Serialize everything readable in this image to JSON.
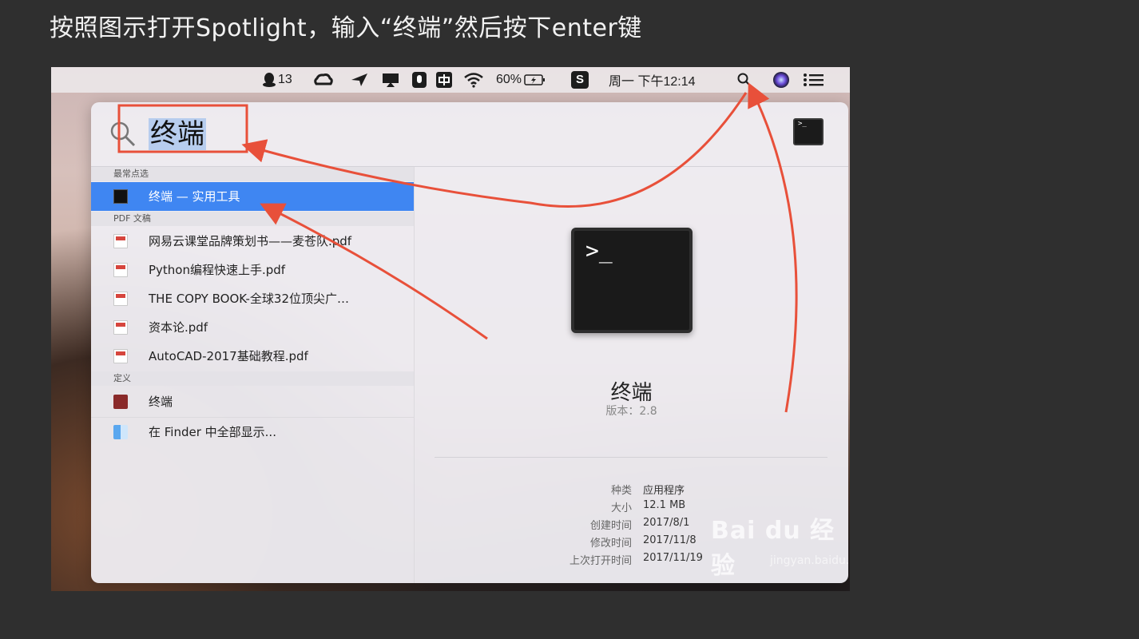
{
  "instruction": "按照图示打开Spotlight，输入“终端”然后按下enter键",
  "menubar": {
    "qq_count": "13",
    "battery": "60%",
    "input_method": "S",
    "clock": "周一 下午12:14"
  },
  "spotlight": {
    "query": "终端",
    "sections": [
      {
        "title": "最常点选",
        "items": [
          {
            "label": "终端 — 实用工具",
            "icon": "terminal-icon",
            "selected": true
          }
        ]
      },
      {
        "title": "PDF 文稿",
        "items": [
          {
            "label": "网易云课堂品牌策划书——麦苍队.pdf",
            "icon": "pdf-icon"
          },
          {
            "label": "Python编程快速上手.pdf",
            "icon": "pdf-icon"
          },
          {
            "label": "THE COPY BOOK-全球32位顶尖广…",
            "icon": "pdf-icon"
          },
          {
            "label": "资本论.pdf",
            "icon": "pdf-icon"
          },
          {
            "label": "AutoCAD-2017基础教程.pdf",
            "icon": "pdf-icon"
          }
        ]
      },
      {
        "title": "定义",
        "items": [
          {
            "label": "终端",
            "icon": "dictionary-icon"
          },
          {
            "label": "在 Finder 中全部显示...",
            "icon": "finder-icon"
          }
        ]
      }
    ],
    "preview": {
      "prompt": ">_",
      "app_name": "终端",
      "version": "版本：2.8",
      "details": [
        {
          "key": "种类",
          "value": "应用程序"
        },
        {
          "key": "大小",
          "value": "12.1 MB"
        },
        {
          "key": "创建时间",
          "value": "2017/8/1"
        },
        {
          "key": "修改时间",
          "value": "2017/11/8"
        },
        {
          "key": "上次打开时间",
          "value": "2017/11/19"
        }
      ]
    }
  },
  "watermark": {
    "brand": "Bai du 经验",
    "url": "jingyan.baidu.com"
  },
  "colors": {
    "annotation": "#e8503a",
    "selection": "#3f86f2"
  }
}
